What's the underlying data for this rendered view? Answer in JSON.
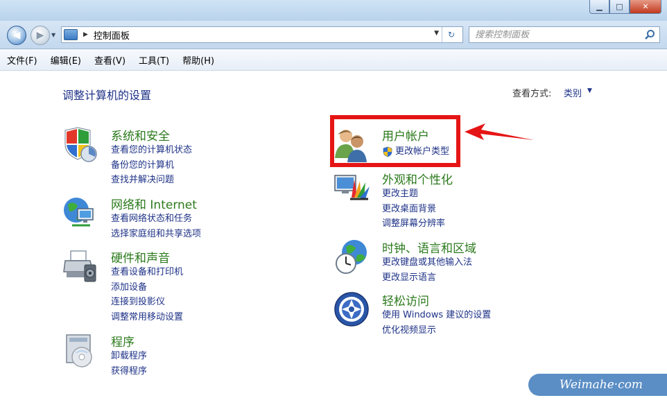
{
  "window": {
    "minimize": "▁",
    "maximize": "□",
    "close": "✕"
  },
  "address": {
    "path": "控制面板",
    "search_placeholder": "搜索控制面板"
  },
  "menu": [
    "文件(F)",
    "编辑(E)",
    "查看(V)",
    "工具(T)",
    "帮助(H)"
  ],
  "main": {
    "title": "调整计算机的设置",
    "view_by_label": "查看方式:",
    "view_by_value": "类别"
  },
  "categories": {
    "system_security": {
      "title": "系统和安全",
      "icon": "shield-icon",
      "links": [
        "查看您的计算机状态",
        "备份您的计算机",
        "查找并解决问题"
      ]
    },
    "network": {
      "title": "网络和 Internet",
      "icon": "network-globe-icon",
      "links": [
        "查看网络状态和任务",
        "选择家庭组和共享选项"
      ]
    },
    "hardware": {
      "title": "硬件和声音",
      "icon": "printer-icon",
      "links": [
        "查看设备和打印机",
        "添加设备",
        "连接到投影仪",
        "调整常用移动设置"
      ]
    },
    "programs": {
      "title": "程序",
      "icon": "programs-disc-icon",
      "links": [
        "卸载程序",
        "获得程序"
      ]
    },
    "user_accounts": {
      "title": "用户帐户",
      "icon": "users-icon",
      "links": [
        "更改帐户类型"
      ]
    },
    "appearance": {
      "title": "外观和个性化",
      "icon": "monitor-palette-icon",
      "links": [
        "更改主题",
        "更改桌面背景",
        "调整屏幕分辨率"
      ]
    },
    "clock": {
      "title": "时钟、语言和区域",
      "icon": "clock-globe-icon",
      "links": [
        "更改键盘或其他输入法",
        "更改显示语言"
      ]
    },
    "ease": {
      "title": "轻松访问",
      "icon": "ease-of-access-icon",
      "links": [
        "使用 Windows 建议的设置",
        "优化视频显示"
      ]
    }
  },
  "watermark": "Weimahe·com",
  "colors": {
    "category_title": "#2b7a1c",
    "link": "#1e3287",
    "highlight": "#e61515"
  }
}
